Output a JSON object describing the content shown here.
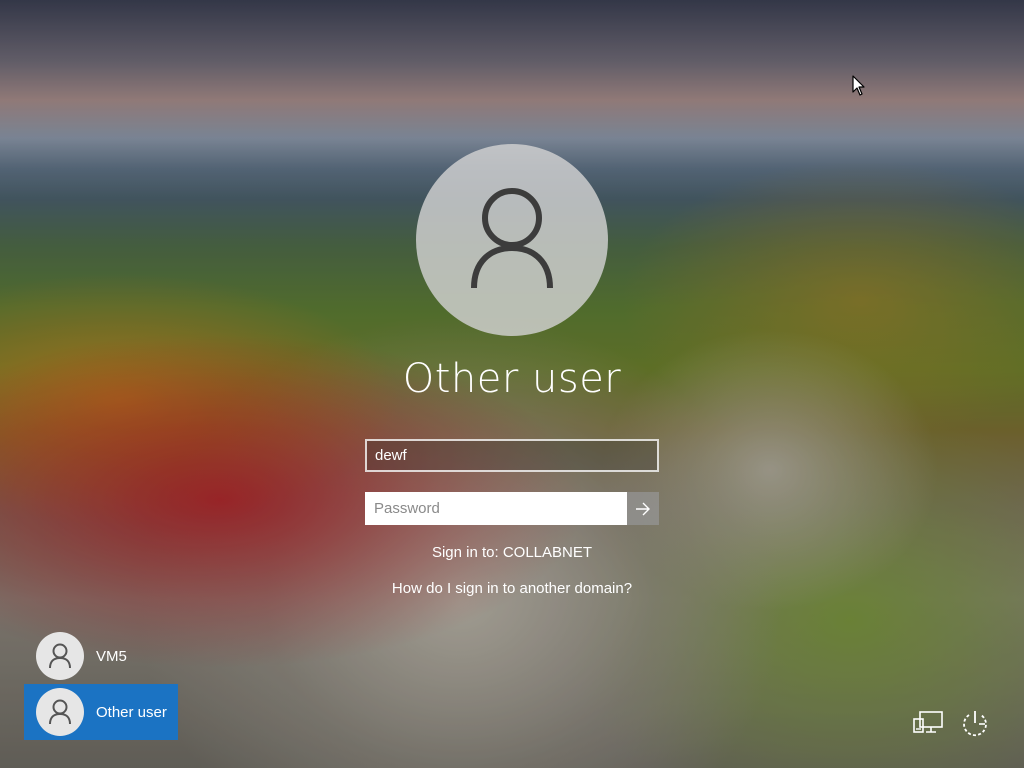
{
  "login": {
    "user_title": "Other user",
    "username_value": "dewf",
    "password_placeholder": "Password",
    "sign_in_to": "Sign in to: COLLABNET",
    "domain_help_link": "How do I sign in to another domain?"
  },
  "user_tiles": [
    {
      "label": "VM5",
      "selected": false
    },
    {
      "label": "Other user",
      "selected": true
    }
  ],
  "corner_icons": {
    "network": "network-icon",
    "power": "power-icon"
  },
  "colors": {
    "selected_tile": "#1b73c3",
    "text": "#ffffff"
  }
}
